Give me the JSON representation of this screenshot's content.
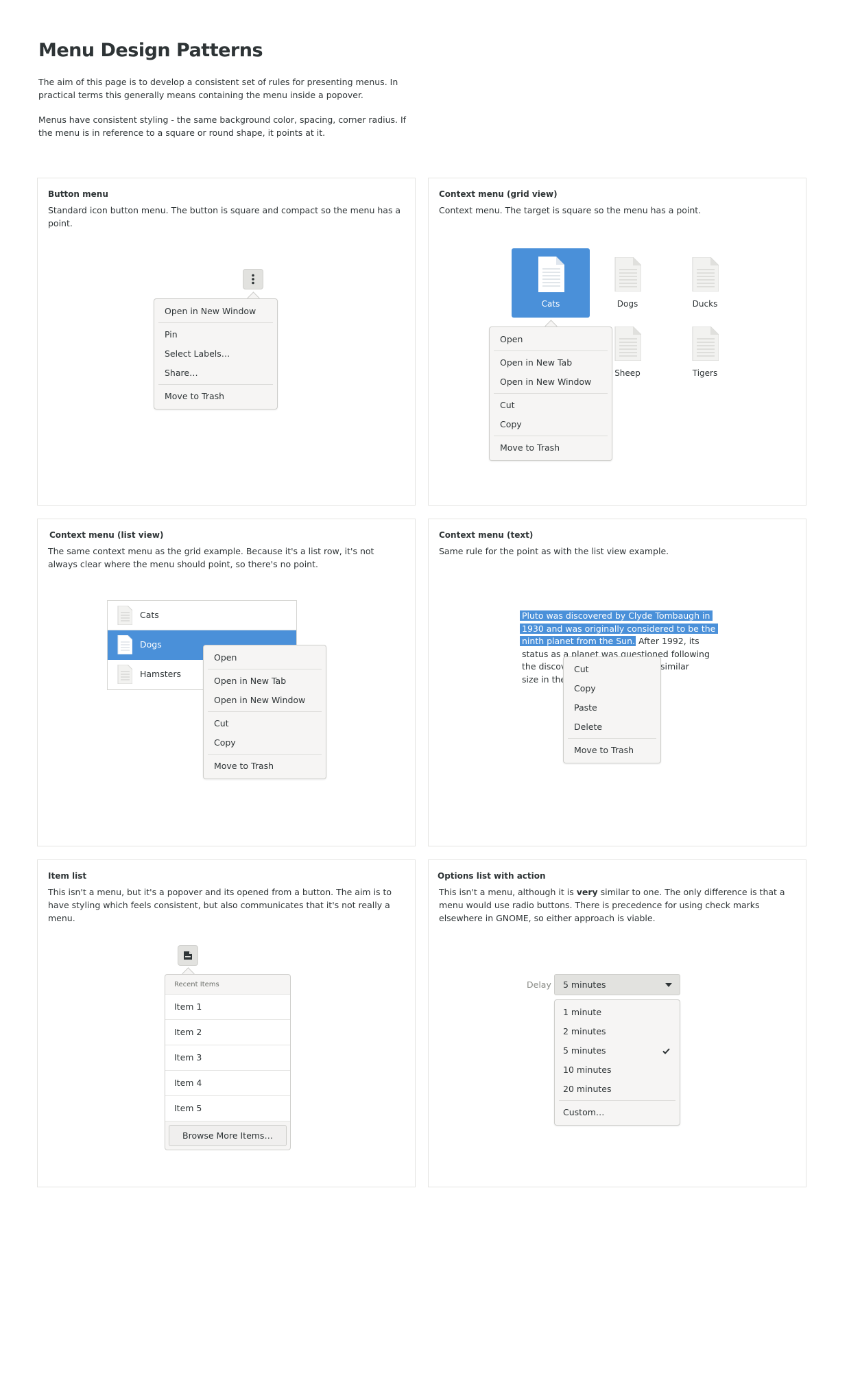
{
  "page": {
    "title": "Menu Design Patterns",
    "intro_1": "The aim of this page is to develop a consistent set of rules for presenting menus. In practical terms this generally means containing the menu inside a popover.",
    "intro_2": "Menus have consistent styling - the same background color, spacing, corner radius. If the menu is in reference to a square or round shape, it points at it."
  },
  "colors": {
    "accent": "#4a90d9",
    "menu_bg": "#f6f5f4",
    "border": "#cdcdca",
    "text": "#2e3436"
  },
  "button_menu": {
    "title": "Button menu",
    "desc": "Standard icon button menu. The button is square and compact so the menu has a point.",
    "icon": "view-more-vertical-icon",
    "items": [
      "Open in New Window",
      "Pin",
      "Select Labels…",
      "Share…",
      "Move to Trash"
    ]
  },
  "grid_menu": {
    "title": "Context menu (grid view)",
    "desc": "Context menu. The target is square so the menu has a point.",
    "files": [
      "Cats",
      "Dogs",
      "Ducks",
      "Sheep",
      "Tigers"
    ],
    "items": [
      "Open",
      "Open in New Tab",
      "Open in New Window",
      "Cut",
      "Copy",
      "Move to Trash"
    ]
  },
  "list_menu": {
    "title": "Context menu (list view)",
    "desc": "The same context menu as the grid example. Because it's a list row, it's not always clear where the menu should point, so there's no point.",
    "rows": [
      "Cats",
      "Dogs",
      "Hamsters"
    ],
    "items": [
      "Open",
      "Open in New Tab",
      "Open in New Window",
      "Cut",
      "Copy",
      "Move to Trash"
    ]
  },
  "text_menu": {
    "title": "Context menu (text)",
    "desc": "Same rule for the point as with the list view example.",
    "selected_1": "Pluto was discovered by Clyde Tombaugh in",
    "selected_2": "1930 and was originally considered to be the",
    "selected_3": "ninth planet from the Sun.",
    "rest_3": " After 1992, its",
    "line_4": "status as a planet was questioned following",
    "line_5a": "the discov",
    "line_5b": "similar",
    "line_6": "size in the",
    "items": [
      "Cut",
      "Copy",
      "Paste",
      "Delete",
      "Move to Trash"
    ]
  },
  "item_list": {
    "title": "Item list",
    "desc": "This isn't a menu, but it's a popover and its opened from a button. The aim is to have styling which feels consistent, but also communicates that it's not really a menu.",
    "icon": "document-open-recent-icon",
    "header": "Recent Items",
    "items": [
      "Item 1",
      "Item 2",
      "Item 3",
      "Item 4",
      "Item 5"
    ],
    "button": "Browse More Items…"
  },
  "options_list": {
    "title": "Options list with action",
    "desc_1": "This isn't a menu, although it is ",
    "desc_bold": "very",
    "desc_2": " similar to one. The only difference is that a menu would use radio buttons. There is precedence for using check marks elsewhere in GNOME, so either approach is viable.",
    "label": "Delay",
    "selected": "5 minutes",
    "options": [
      "1 minute",
      "2 minutes",
      "5 minutes",
      "10 minutes",
      "20 minutes"
    ],
    "checked_index": 2,
    "action": "Custom…"
  }
}
